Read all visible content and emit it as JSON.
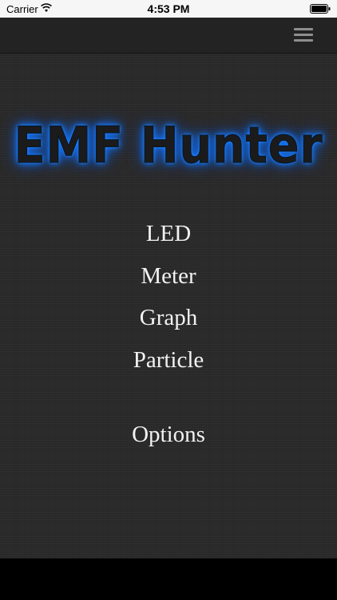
{
  "status_bar": {
    "carrier": "Carrier",
    "time": "4:53 PM",
    "wifi_icon": "wifi-icon",
    "battery_icon": "battery-icon"
  },
  "nav_bar": {
    "menu_icon": "hamburger-menu-icon"
  },
  "app": {
    "logo_text": "EMF Hunter",
    "glow_color": "#1f8fff"
  },
  "menu": {
    "items": [
      {
        "label": "LED"
      },
      {
        "label": "Meter"
      },
      {
        "label": "Graph"
      },
      {
        "label": "Particle"
      }
    ],
    "options_label": "Options"
  },
  "colors": {
    "background": "#2a2a2a",
    "text": "#f2f2f2",
    "status_bar_bg": "#f6f6f6"
  }
}
